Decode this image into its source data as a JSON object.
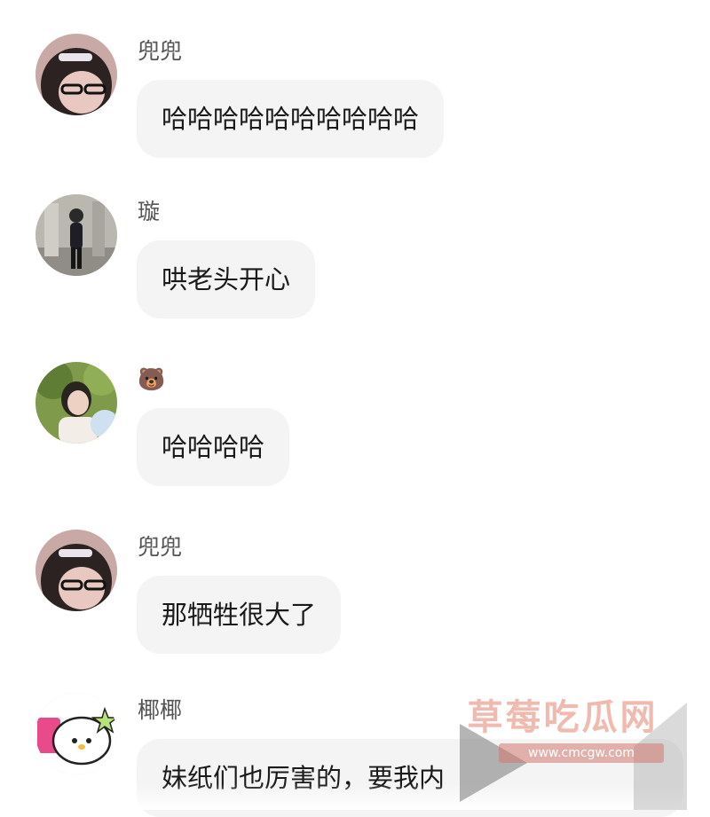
{
  "messages": [
    {
      "sender": "兜兜",
      "text": "哈哈哈哈哈哈哈哈哈哈"
    },
    {
      "sender": "璇",
      "text": "哄老头开心"
    },
    {
      "sender": "🐻",
      "text": "哈哈哈哈"
    },
    {
      "sender": "兜兜",
      "text": "那牺牲很大了"
    },
    {
      "sender": "椰椰",
      "text": "妹纸们也厉害的，要我内"
    }
  ],
  "watermark": {
    "title": "草莓吃瓜网",
    "url": "www.cmcgw.com"
  },
  "colors": {
    "bubble": "#f4f4f5",
    "name": "#555555",
    "text": "#1a1a1a"
  }
}
